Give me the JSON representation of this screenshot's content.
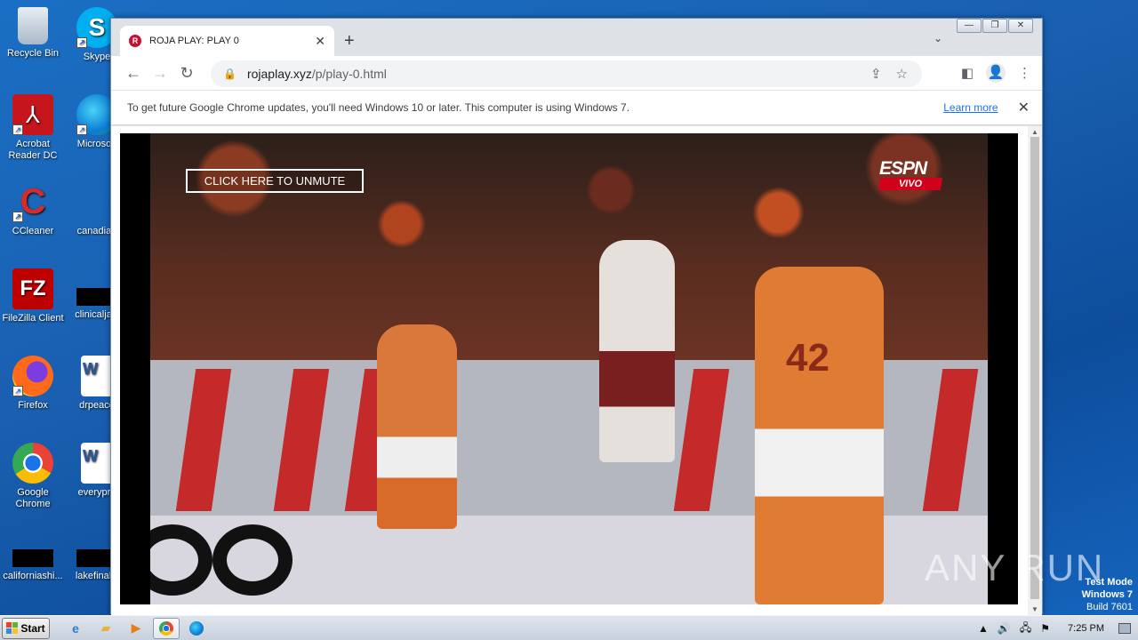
{
  "desktop": {
    "icons": [
      {
        "label": "Recycle Bin"
      },
      {
        "label": "Skype"
      },
      {
        "label": "Acrobat Reader DC"
      },
      {
        "label": "Microsoft"
      },
      {
        "label": "CCleaner"
      },
      {
        "label": "canadian"
      },
      {
        "label": "FileZilla Client"
      },
      {
        "label": "clinicaljacl"
      },
      {
        "label": "Firefox"
      },
      {
        "label": "drpeace"
      },
      {
        "label": "Google Chrome"
      },
      {
        "label": "everypre"
      },
      {
        "label": "californiashi..."
      },
      {
        "label": "lakefinally"
      }
    ]
  },
  "browser": {
    "tab": {
      "title": "ROJA PLAY: PLAY 0",
      "favicon_letter": "R"
    },
    "url": {
      "host": "rojaplay.xyz",
      "path": "/p/play-0.html"
    },
    "infobar": {
      "message": "To get future Google Chrome updates, you'll need Windows 10 or later. This computer is using Windows 7.",
      "link": "Learn more"
    }
  },
  "player": {
    "unmute_label": "CLICK HERE TO UNMUTE",
    "logo_top": "ESPN",
    "logo_bottom": "VIVO",
    "jersey_number": "42"
  },
  "watermark": {
    "text": "ANY RUN"
  },
  "testmode": {
    "line1": "Test Mode",
    "line2": "Windows 7",
    "line3": "Build 7601"
  },
  "taskbar": {
    "start_label": "Start",
    "clock": "7:25 PM"
  }
}
